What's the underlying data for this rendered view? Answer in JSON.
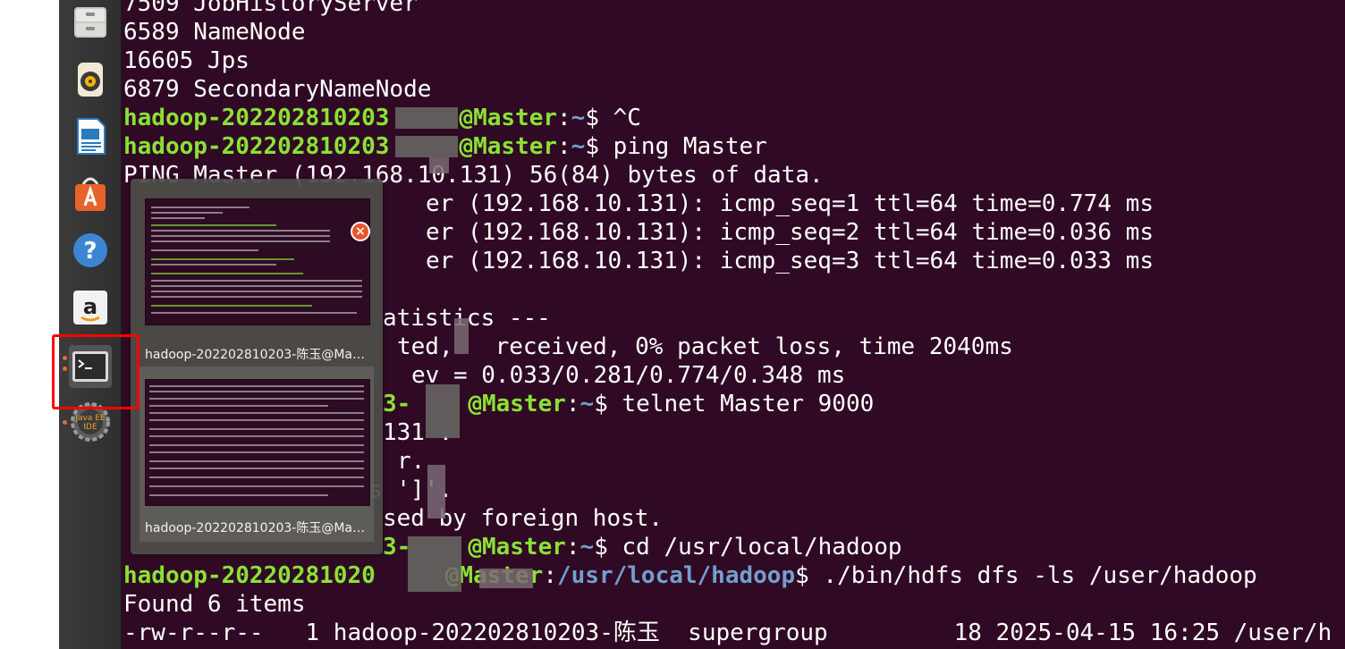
{
  "launcher": {
    "items": [
      {
        "name": "files-icon"
      },
      {
        "name": "rhythmbox-icon"
      },
      {
        "name": "libreoffice-writer-icon"
      },
      {
        "name": "software-center-icon"
      },
      {
        "name": "help-icon"
      },
      {
        "name": "amazon-icon"
      },
      {
        "name": "terminal-icon"
      },
      {
        "name": "eclipse-java-ee-icon",
        "label": "Java EE IDE"
      }
    ],
    "accent_color": "#e56b2e"
  },
  "terminal": {
    "background": "#300a24",
    "prompt_color": "#8ae234",
    "path_color": "#729fcf",
    "user_host": "hadoop-202202810203",
    "lines": [
      "7509 JobHistoryServer",
      "6589 NameNode",
      "16605 Jps",
      "6879 SecondaryNameNode",
      "PING Master (192.168.10.131) 56(84) bytes of data.",
      "er (192.168.10.131): icmp_seq=1 ttl=64 time=0.774 ms",
      "er (192.168.10.131): icmp_seq=2 ttl=64 time=0.036 ms",
      "er (192.168.10.131): icmp_seq=3 ttl=64 time=0.033 ms",
      "atistics ---",
      "ted,   received, 0% packet loss, time 2040ms",
      "ev = 0.033/0.281/0.774/0.348 ms",
      "131 .",
      "r.",
      "s ']'.",
      "sed by foreign host.",
      "Found 6 items",
      "-rw-r--r--   1 hadoop-202202810203-陈玉  supergroup         18 2025-04-15 16:25 /user/h"
    ],
    "prompts": [
      {
        "user": "hadoop-202202810203",
        "host": "@Master",
        "sep": ":",
        "path": "~",
        "cmd": "$ ^C"
      },
      {
        "user": "hadoop-202202810203",
        "host": "@Master",
        "sep": ":",
        "path": "~",
        "cmd": "$ ping Master"
      },
      {
        "user": "3-",
        "host": "@Master",
        "sep": ":",
        "path": "~",
        "cmd": "$ telnet Master 9000"
      },
      {
        "user": "3-",
        "host": "@Master",
        "sep": ":",
        "path": "~",
        "cmd": "$ cd /usr/local/hadoop"
      },
      {
        "user": "hadoop-20220281020",
        "host": "@Master",
        "sep": ":",
        "path": "/usr/local/hadoop",
        "cmd": "$ ./bin/hdfs dfs -ls /user/hadoop"
      }
    ]
  },
  "switcher": {
    "windows": [
      {
        "title": "hadoop-202202810203-陈玉@Mast..."
      },
      {
        "title": "hadoop-202202810203-陈玉@Mast..."
      }
    ],
    "close_label": "×"
  }
}
